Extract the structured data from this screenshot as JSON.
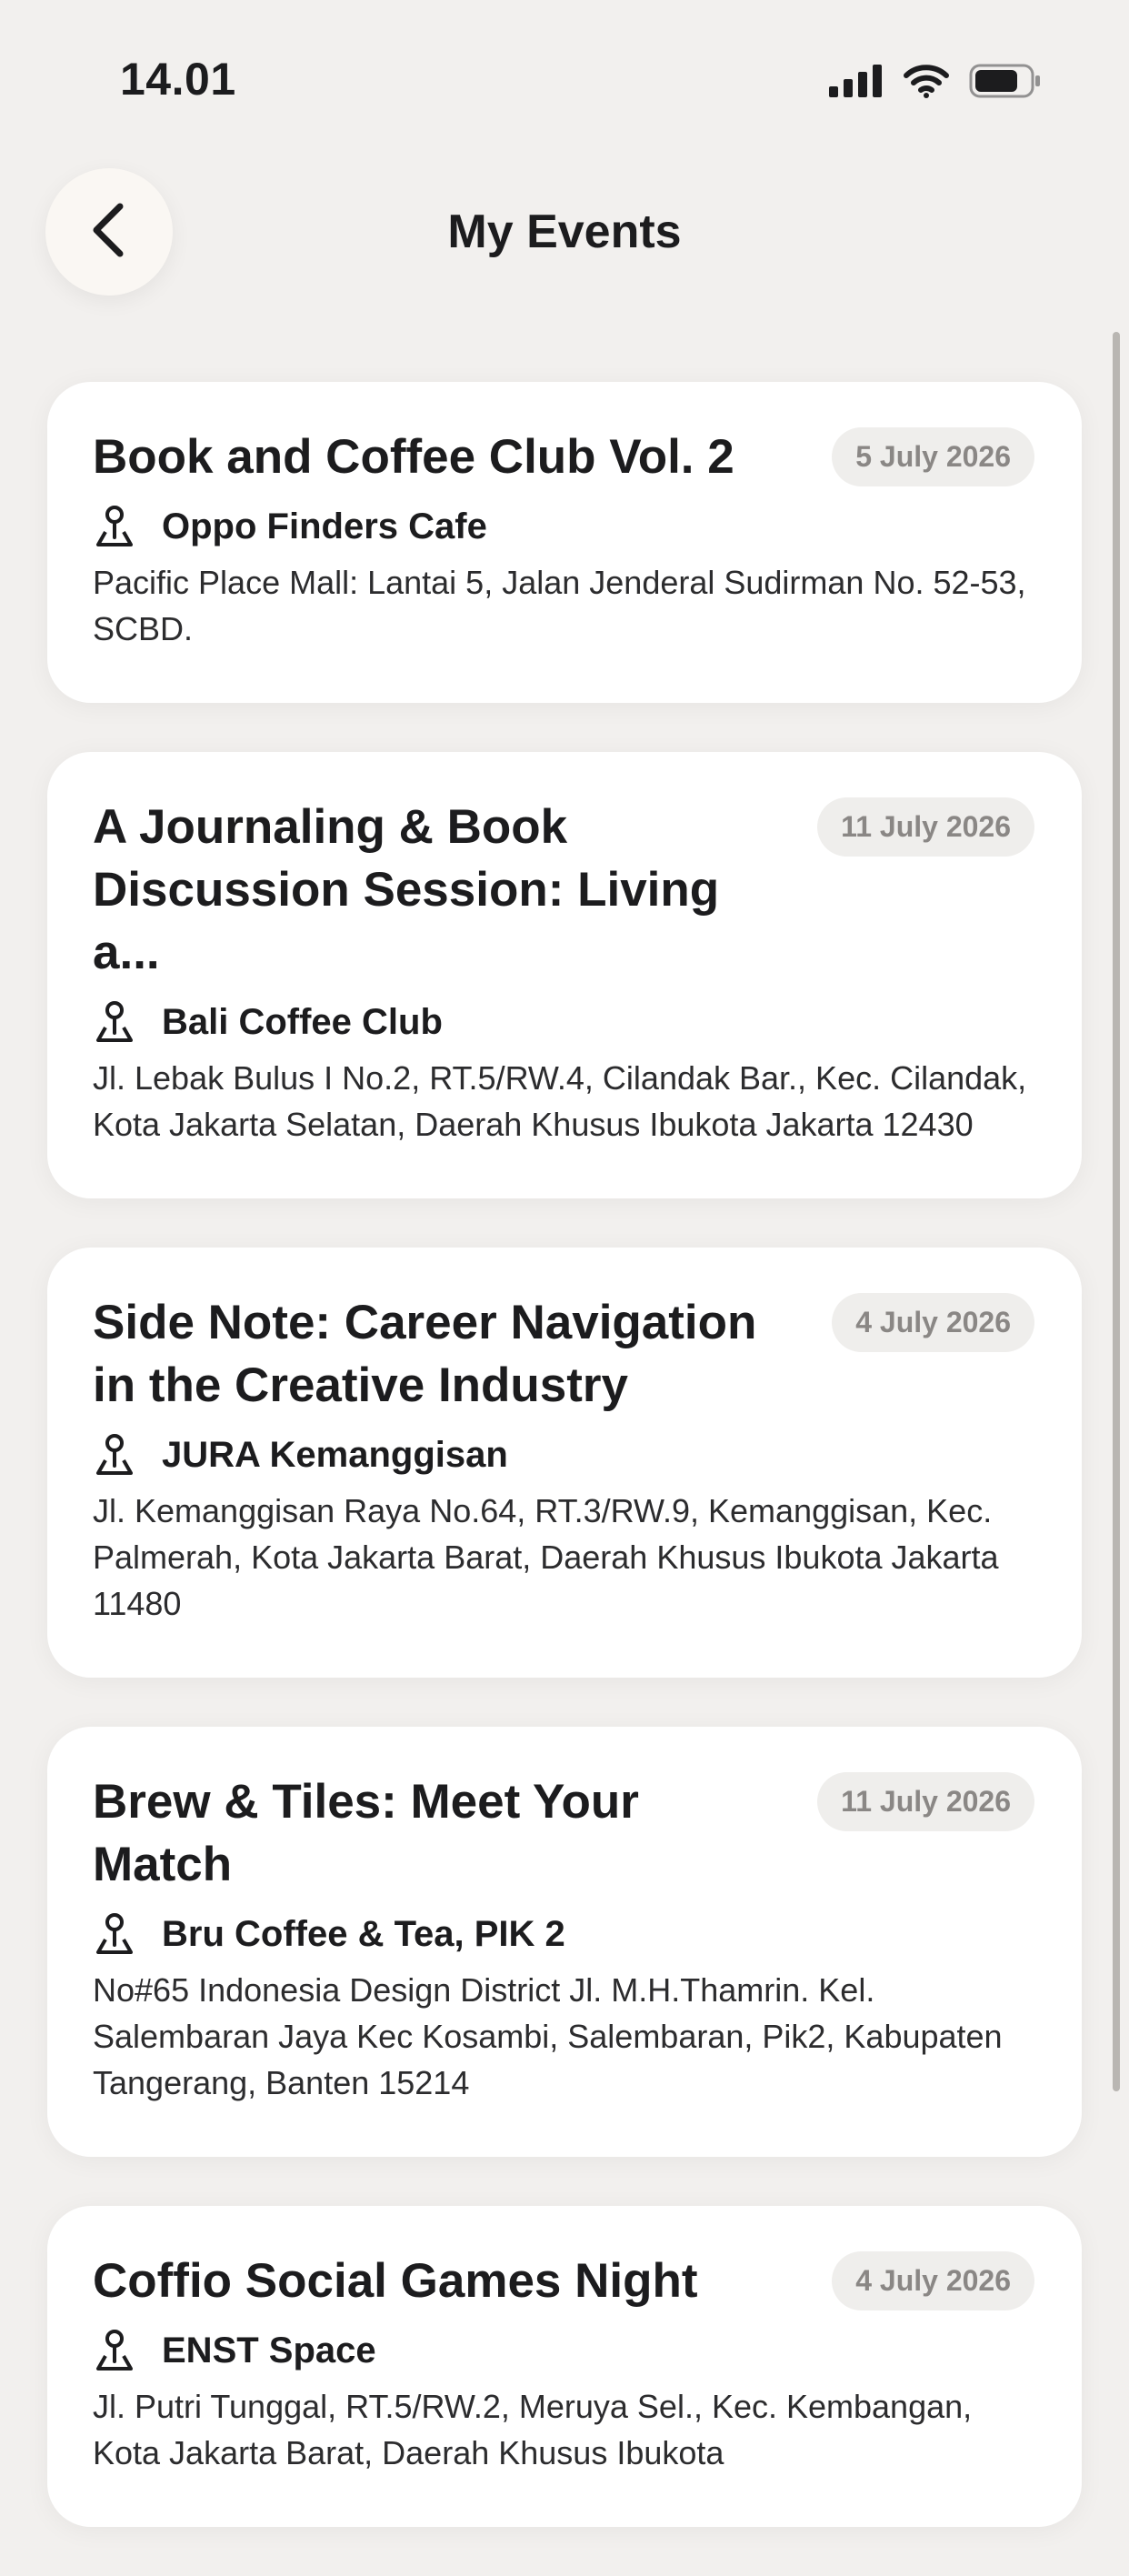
{
  "status_bar": {
    "time": "14.01"
  },
  "header": {
    "title": "My Events",
    "back_icon": "chevron-left-icon"
  },
  "events": [
    {
      "title": "Book and Coffee Club Vol. 2",
      "date": "5 July 2026",
      "venue": "Oppo Finders Cafe",
      "address": "Pacific Place Mall: Lantai 5, Jalan Jenderal Sudirman No. 52-53, SCBD."
    },
    {
      "title": "A Journaling & Book Discussion Session: Living a...",
      "date": "11 July 2026",
      "venue": "Bali Coffee Club",
      "address": "Jl. Lebak Bulus I No.2, RT.5/RW.4, Cilandak Bar., Kec. Cilandak, Kota Jakarta Selatan, Daerah Khusus Ibukota Jakarta 12430"
    },
    {
      "title": "Side Note: Career Navigation in the Creative Industry",
      "date": "4 July 2026",
      "venue": "JURA Kemanggisan",
      "address": "Jl. Kemanggisan Raya No.64, RT.3/RW.9, Kemanggisan, Kec. Palmerah, Kota Jakarta Barat, Daerah Khusus Ibukota Jakarta 11480"
    },
    {
      "title": "Brew & Tiles: Meet Your Match",
      "date": "11 July 2026",
      "venue": "Bru Coffee & Tea, PIK 2",
      "address": "No#65 Indonesia Design District Jl. M.H.Thamrin. Kel. Salembaran Jaya Kec Kosambi, Salembaran, Pik2, Kabupaten Tangerang, Banten 15214"
    },
    {
      "title": "Coffio Social Games Night",
      "date": "4 July 2026",
      "venue": "ENST Space",
      "address": "Jl. Putri Tunggal, RT.5/RW.2, Meruya Sel., Kec. Kembangan, Kota Jakarta Barat, Daerah Khusus Ibukota"
    }
  ],
  "colors": {
    "background": "#f2f0ee",
    "card": "#ffffff",
    "badge_bg": "#efeeec",
    "badge_text": "#8a8785"
  }
}
